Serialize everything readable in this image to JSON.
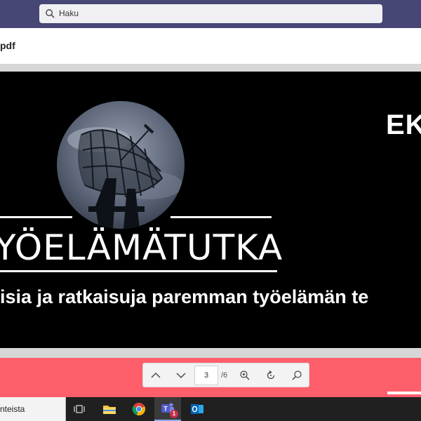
{
  "app": {
    "search_placeholder": "Haku"
  },
  "file": {
    "name": "pdf"
  },
  "slide": {
    "title": "YÖELÄMÄTUTKA",
    "subtitle": "isia ja ratkaisuja paremman työelämän te",
    "corner_text": "EKC"
  },
  "pdf_toolbar": {
    "current_page": "3",
    "total_pages": "/6"
  },
  "taskbar": {
    "search_text": "nteista",
    "teams_badge": "1"
  },
  "colors": {
    "teams_header": "#464775",
    "slide_background": "#000000",
    "next_page_background": "#ff5e6b",
    "taskbar": "#202020"
  }
}
